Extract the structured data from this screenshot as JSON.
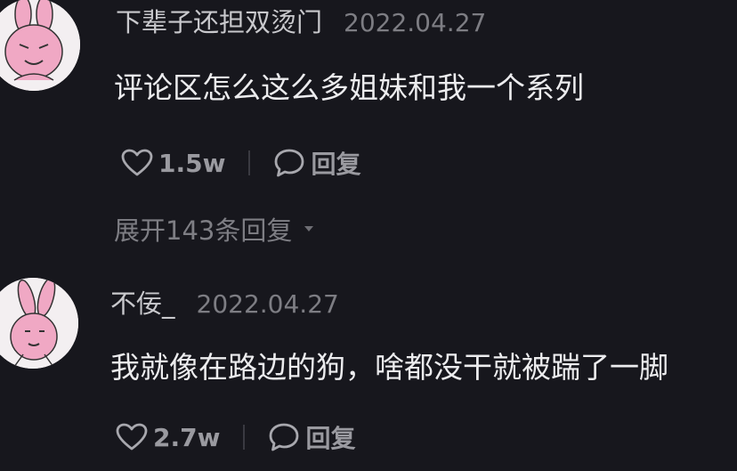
{
  "comments": [
    {
      "username": "下辈子还担双烫门",
      "date": "2022.04.27",
      "text": "评论区怎么这么多姐妹和我一个系列",
      "likes": "1.5w",
      "reply_label": "回复",
      "expand_replies": "展开143条回复"
    },
    {
      "username": "不佞_",
      "date": "2022.04.27",
      "text": "我就像在路边的狗，啥都没干就被踹了一脚",
      "likes": "2.7w",
      "reply_label": "回复"
    }
  ],
  "icons": {
    "like": "heart-outline-icon",
    "reply": "speech-bubble-icon",
    "expand": "caret-down-icon"
  },
  "colors": {
    "background": "#17171d",
    "avatar_pink": "#f0a8c4"
  }
}
